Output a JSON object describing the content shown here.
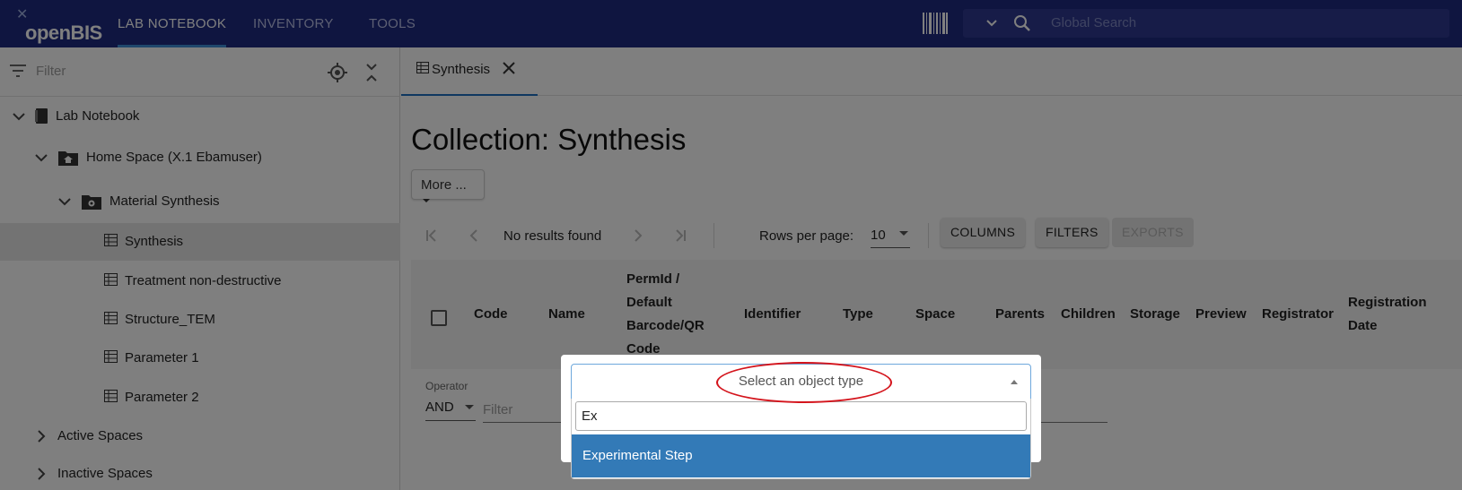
{
  "appbar": {
    "logo_text": "openBIS",
    "tabs": [
      {
        "label": "LAB NOTEBOOK",
        "active": true
      },
      {
        "label": "INVENTORY",
        "active": false
      },
      {
        "label": "TOOLS",
        "active": false
      }
    ],
    "search_placeholder": "Global Search",
    "icons": [
      "barcode-icon",
      "chevron-down-icon",
      "search-icon"
    ],
    "bg_color": "#1f2a80"
  },
  "sidebar": {
    "filter_placeholder": "Filter",
    "tree": [
      {
        "label": "Lab Notebook",
        "icon": "notebook-icon",
        "expanded": true
      },
      {
        "label": "Home Space (X.1 Ebamuser)",
        "icon": "home-folder-icon",
        "expanded": true
      },
      {
        "label": "Material Synthesis",
        "icon": "settings-folder-icon",
        "expanded": true
      },
      {
        "label": "Synthesis",
        "icon": "table-icon",
        "selected": true
      },
      {
        "label": "Treatment non-destructive",
        "icon": "table-icon"
      },
      {
        "label": "Structure_TEM",
        "icon": "table-icon"
      },
      {
        "label": "Parameter 1",
        "icon": "table-icon"
      },
      {
        "label": "Parameter 2",
        "icon": "table-icon"
      },
      {
        "label": "Active Spaces",
        "expanded": false
      },
      {
        "label": "Inactive Spaces",
        "expanded": false
      }
    ]
  },
  "main": {
    "tab_label": "Synthesis",
    "title": "Collection: Synthesis",
    "more_button": "More ...",
    "pager": {
      "status": "No results found",
      "rows_label": "Rows per page:",
      "rows_value": "10",
      "columns_btn": "COLUMNS",
      "filters_btn": "FILTERS",
      "exports_btn": "EXPORTS"
    },
    "columns": [
      "Code",
      "Name",
      "PermId / Default Barcode/QR Code",
      "Identifier",
      "Type",
      "Space",
      "Parents",
      "Children",
      "Storage",
      "Preview",
      "Registrator",
      "Registration Date"
    ],
    "operator_label": "Operator",
    "operator_value": "AND",
    "filter_placeholder": "Filter"
  },
  "modal": {
    "select_placeholder": "Select an object type",
    "search_value": "Ex",
    "options": [
      "Experimental Step"
    ],
    "highlight_color": "#337ab7",
    "annotation_color": "#d4141c"
  }
}
